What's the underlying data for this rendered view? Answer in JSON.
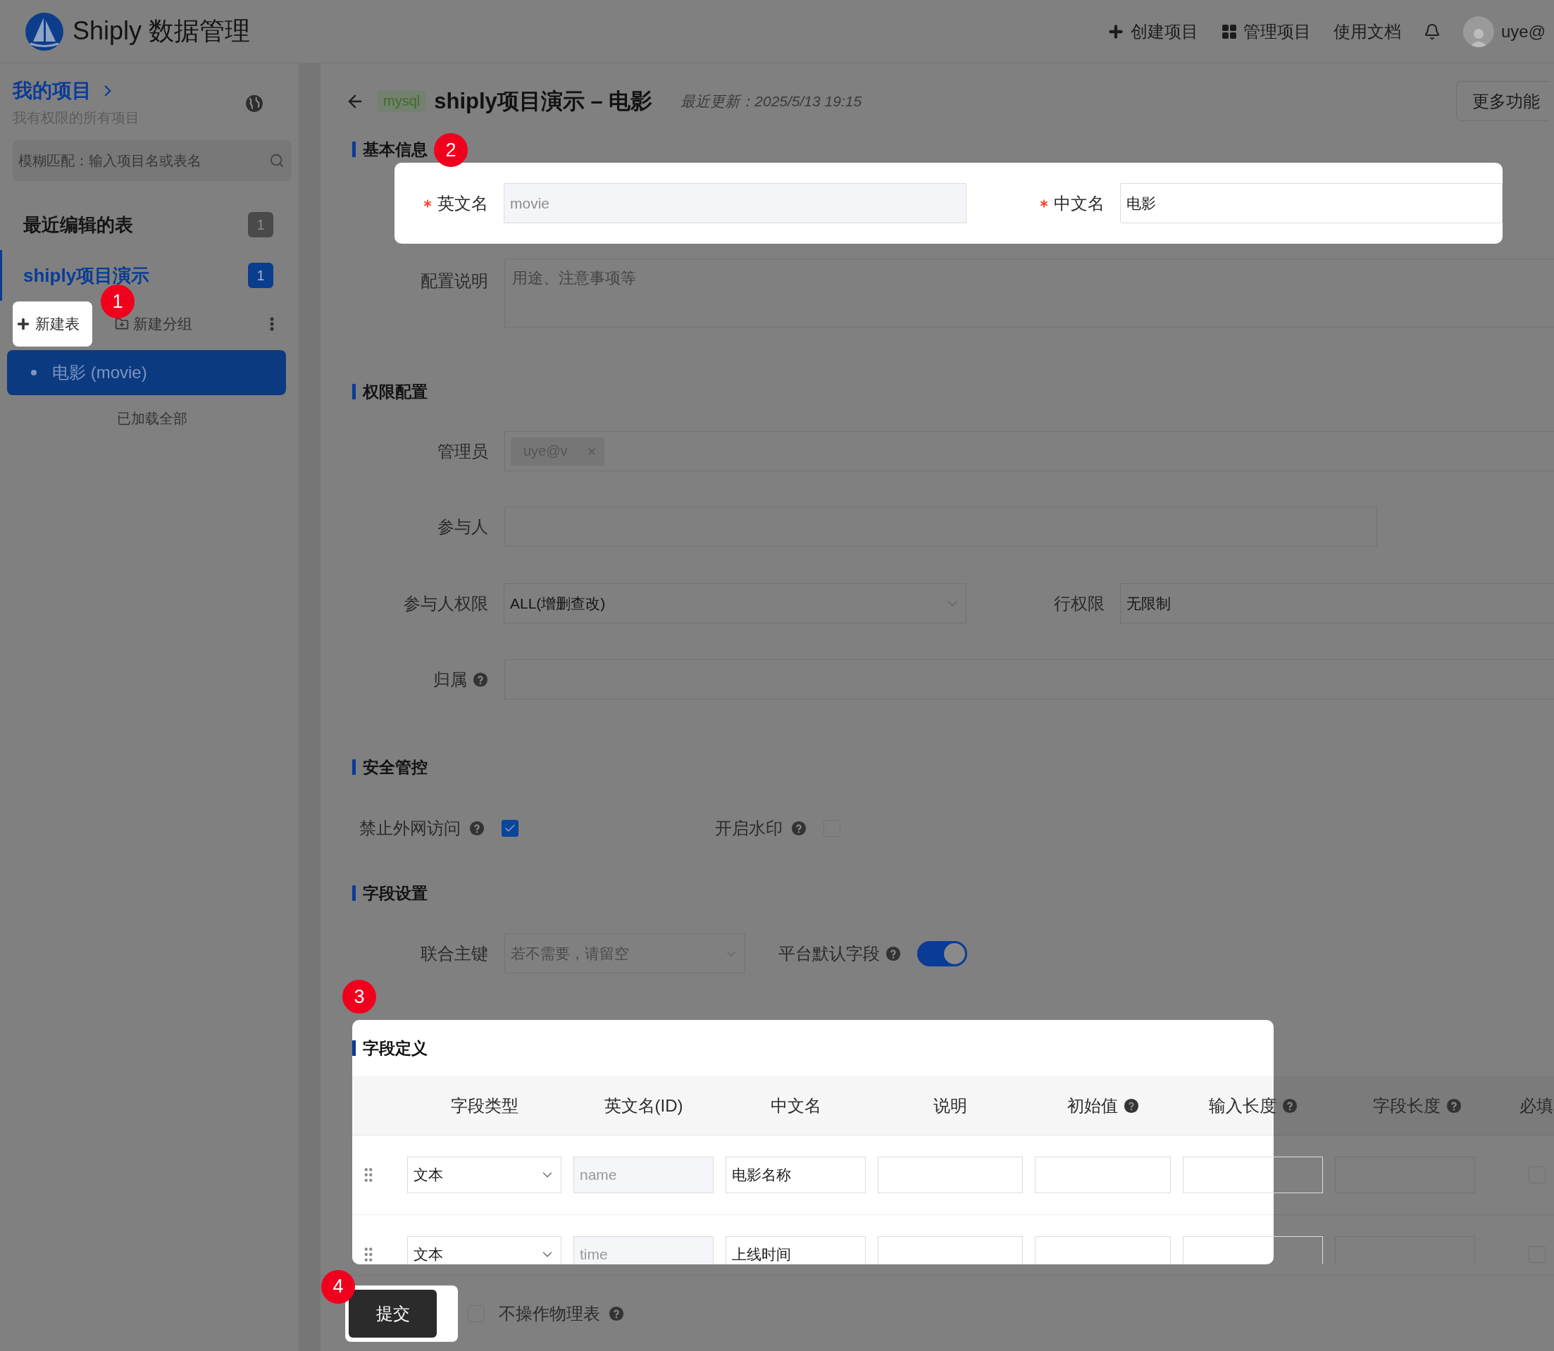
{
  "header": {
    "brand": "Shiply 数据管理",
    "nav": [
      {
        "kind": "create",
        "label": "创建项目"
      },
      {
        "kind": "manage",
        "label": "管理项目"
      },
      {
        "kind": "docs",
        "label": "使用文档"
      }
    ],
    "user": "uye@"
  },
  "sidebar": {
    "title": "我的项目",
    "subtitle": "我有权限的所有项目",
    "search": {
      "placeholder": "模糊匹配：输入项目名或表名"
    },
    "groups": [
      {
        "label": "最近编辑的表",
        "count": "1",
        "selected": false
      },
      {
        "label": "shiply项目演示",
        "count": "1",
        "selected": true
      }
    ],
    "actions": [
      {
        "kind": "table",
        "label": "新建表",
        "step": "1"
      },
      {
        "kind": "group",
        "label": "新建分组"
      }
    ],
    "tables": [
      {
        "label": "电影 (movie)",
        "selected": true
      }
    ],
    "footer": "已加载全部"
  },
  "page": {
    "db": "mysql",
    "title": "shiply项目演示 – 电影",
    "updated": "最近更新：2025/5/13 19:15",
    "more": "更多功能"
  },
  "basic": {
    "title": "基本信息",
    "step": "2",
    "fields": [
      {
        "label": "英文名",
        "required": true,
        "value": "movie",
        "disabled": true
      },
      {
        "label": "中文名",
        "required": true,
        "value": "电影",
        "disabled": false
      }
    ],
    "description": {
      "label": "配置说明",
      "placeholder": "用途、注意事项等"
    }
  },
  "permissions": {
    "title": "权限配置",
    "admins": {
      "label": "管理员",
      "tags": [
        "uye@v"
      ]
    },
    "participants": {
      "label": "参与人"
    },
    "participant_permission": {
      "label": "参与人权限",
      "value": "ALL(增删查改)"
    },
    "row_permission": {
      "label": "行权限",
      "value": "无限制"
    },
    "owner": {
      "label": "归属",
      "help": true
    }
  },
  "security": {
    "title": "安全管控",
    "options": [
      {
        "label": "禁止外网访问",
        "help": true,
        "checked": true
      },
      {
        "label": "开启水印",
        "help": true,
        "checked": false
      }
    ]
  },
  "field_settings": {
    "title": "字段设置",
    "composite_key": {
      "label": "联合主键",
      "placeholder": "若不需要，请留空"
    },
    "default_fields": {
      "label": "平台默认字段",
      "help": true,
      "on": true
    }
  },
  "field_definition": {
    "title": "字段定义",
    "step": "3",
    "columns": [
      {
        "label": "字段类型"
      },
      {
        "label": "英文名(ID)"
      },
      {
        "label": "中文名"
      },
      {
        "label": "说明"
      },
      {
        "label": "初始值",
        "help": true
      },
      {
        "label": "输入长度",
        "help": true
      },
      {
        "label": "字段长度",
        "help": true
      },
      {
        "label": "必填"
      }
    ],
    "rows": [
      {
        "type": "文本",
        "name": "name",
        "cn_name": "电影名称",
        "required": false
      },
      {
        "type": "文本",
        "name": "time",
        "cn_name": "上线时间",
        "required": false
      }
    ]
  },
  "footer": {
    "submit": "提交",
    "step": "4",
    "option": {
      "label": "不操作物理表",
      "help": true,
      "checked": false
    }
  }
}
